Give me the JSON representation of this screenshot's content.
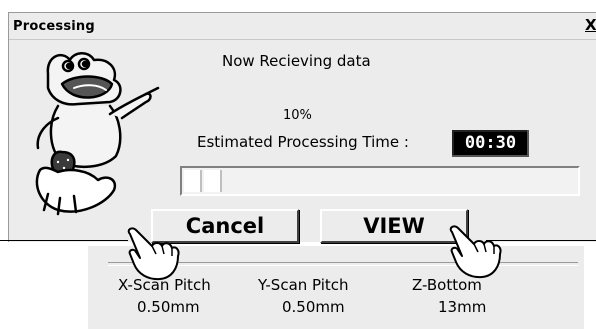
{
  "dialog": {
    "title": "Processing",
    "close_label": "X"
  },
  "status": {
    "message": "Now Recieving data",
    "percent": "10%",
    "time_label": "Estimated Processing Time :",
    "time_value": "00:30"
  },
  "progress": {
    "fraction": 0.1
  },
  "buttons": {
    "cancel_label": "Cancel",
    "view_label": "VIEW"
  },
  "settings": {
    "x_label": "X-Scan Pitch",
    "x_value": "0.50mm",
    "y_label": "Y-Scan Pitch",
    "y_value": "0.50mm",
    "z_label": "Z-Bottom",
    "z_value": "13mm"
  },
  "icons": {
    "mascot": "mascot-illustration",
    "cursor": "hand-pointer-icon",
    "close": "close-icon"
  }
}
